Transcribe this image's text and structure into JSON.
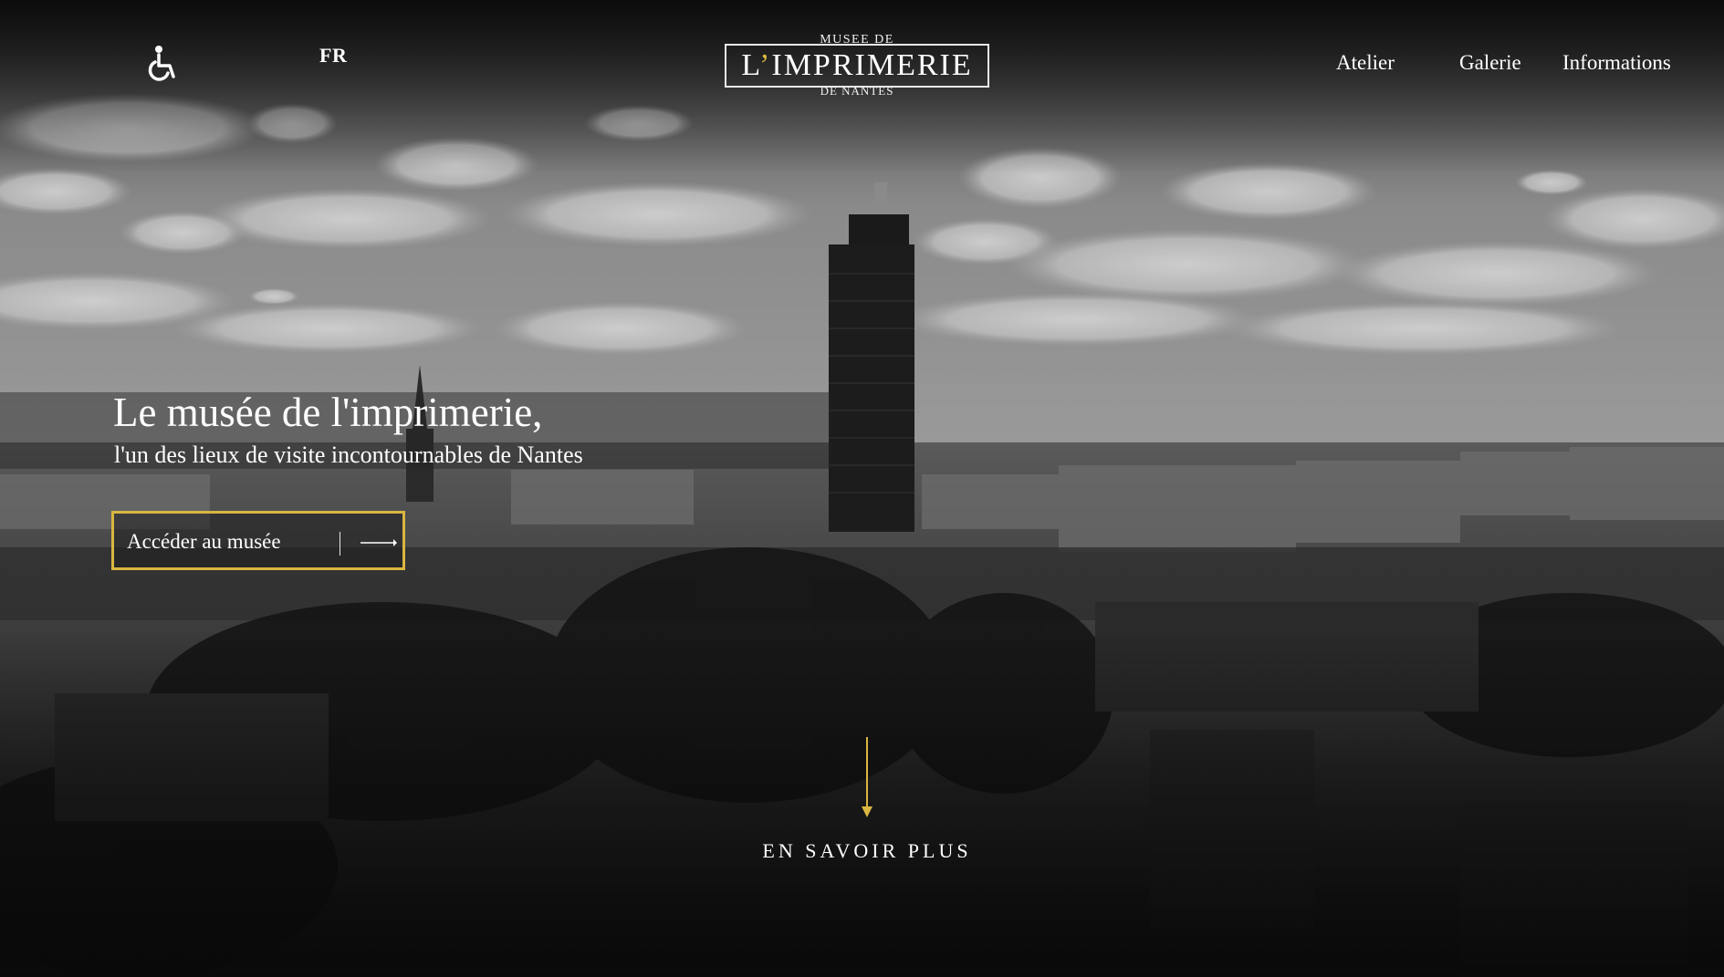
{
  "header": {
    "accessibility_icon": "wheelchair-icon",
    "language": "FR",
    "logo": {
      "top": "MUSEE DE",
      "main_prefix": "L",
      "main_apostrophe": "’",
      "main_suffix": "IMPRIMERIE",
      "bottom": "DE NANTES"
    },
    "nav": {
      "atelier": "Atelier",
      "galerie": "Galerie",
      "informations": "Informations"
    }
  },
  "hero": {
    "title": "Le musée de l'imprimerie,",
    "subtitle": "l'un des lieux de visite incontournables de Nantes",
    "cta": {
      "label": "Accéder au musée",
      "icon": "arrow-right-icon"
    }
  },
  "scroll": {
    "icon": "arrow-down-icon",
    "label": "EN SAVOIR PLUS"
  },
  "colors": {
    "accent": "#d9b640",
    "text": "#ffffff"
  }
}
